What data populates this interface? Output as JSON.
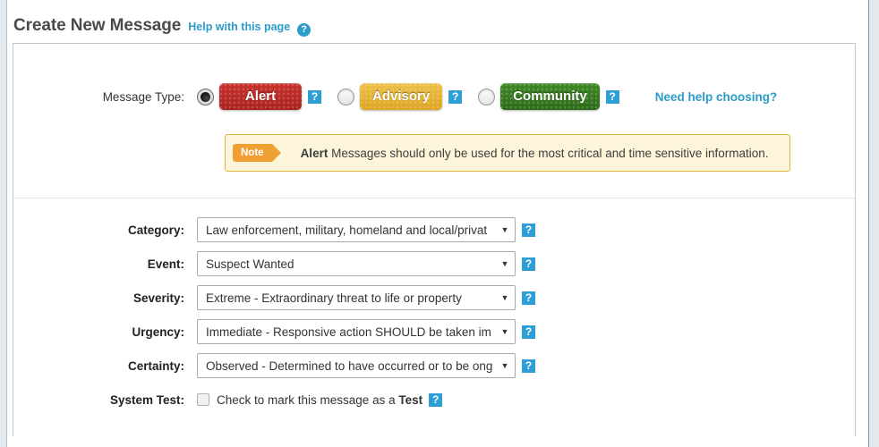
{
  "header": {
    "title": "Create New Message",
    "help_link": "Help with this page",
    "help_icon": "question-circle-icon"
  },
  "message_type": {
    "label": "Message Type:",
    "options": [
      {
        "label": "Alert",
        "selected": true,
        "color": "#b62a26",
        "help_icon": "help-icon"
      },
      {
        "label": "Advisory",
        "selected": false,
        "color": "#e0ae2c",
        "help_icon": "help-icon"
      },
      {
        "label": "Community",
        "selected": false,
        "color": "#357a1f",
        "help_icon": "help-icon"
      }
    ],
    "need_help_link": "Need help choosing?"
  },
  "note": {
    "badge": "Note",
    "bold_lead": "Alert",
    "text": " Messages should only be used for the most critical and time sensitive information.",
    "background": "#fdf5d9",
    "border": "#e3b33a",
    "badge_color": "#f0a032"
  },
  "form": {
    "rows": [
      {
        "label": "Category:",
        "value": "Law enforcement, military, homeland and local/privat",
        "arrow": "▼",
        "help_icon": "help-icon"
      },
      {
        "label": "Event:",
        "value": "Suspect Wanted",
        "arrow": "▼",
        "help_icon": "help-icon"
      },
      {
        "label": "Severity:",
        "value": "Extreme - Extraordinary threat to life or property",
        "arrow": "▼",
        "help_icon": "help-icon"
      },
      {
        "label": "Urgency:",
        "value": "Immediate - Responsive action SHOULD be taken im",
        "arrow": "▼",
        "help_icon": "help-icon"
      },
      {
        "label": "Certainty:",
        "value": "Observed - Determined to have occurred or to be ong",
        "arrow": "▼",
        "help_icon": "help-icon"
      }
    ],
    "system_test": {
      "label": "System Test:",
      "checked": false,
      "text": "Check to mark this message as a ",
      "bold_word": "Test",
      "help_icon": "help-icon"
    }
  },
  "colors": {
    "link": "#2b9bc9",
    "panel_border": "#bfc9cf",
    "help_icon": "#2e9fd4"
  }
}
